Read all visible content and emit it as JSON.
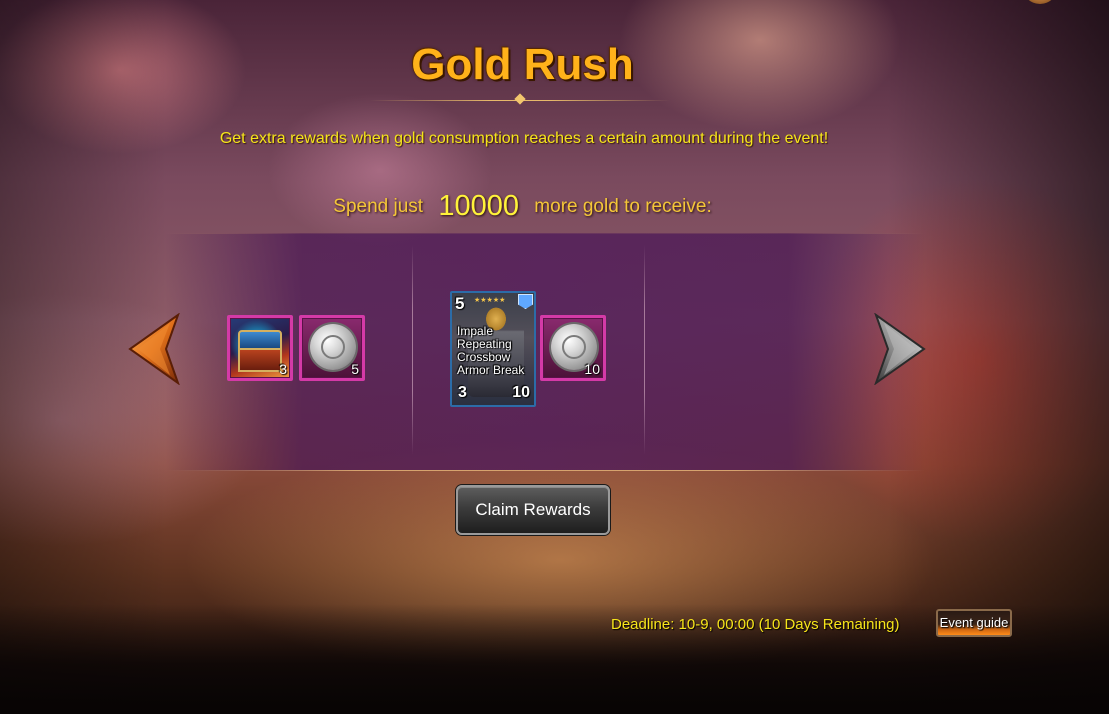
{
  "event": {
    "title": "Gold Rush",
    "subtitle": "Get extra rewards when gold consumption reaches a certain amount during the event!",
    "spend_prefix": "Spend just",
    "spend_amount": "10000",
    "spend_suffix": "more gold to receive:"
  },
  "rewards": {
    "tier1": [
      {
        "icon": "treasure-chest-icon",
        "qty": "3"
      },
      {
        "icon": "silver-coin-icon",
        "qty": "5"
      }
    ],
    "tier2": {
      "card": {
        "level": "5",
        "stars": "★★★★★",
        "skills": [
          "Impale",
          "Repeating",
          "Crossbow",
          "Armor Break"
        ],
        "attack": "3",
        "health": "10"
      },
      "coin": {
        "icon": "silver-coin-icon",
        "qty": "10"
      }
    }
  },
  "claim_button": "Claim Rewards",
  "deadline": "Deadline: 10-9, 00:00 (10 Days Remaining)",
  "event_guide_button": "Event guide",
  "colors": {
    "title": "#ffb21a",
    "subtitle": "#f5e51a",
    "spend_text": "#f4c638",
    "spend_amount": "#fff23a",
    "slot_border": "#d43aa7",
    "left_arrow": "#e07a1a",
    "right_arrow": "#8a8a8a"
  }
}
